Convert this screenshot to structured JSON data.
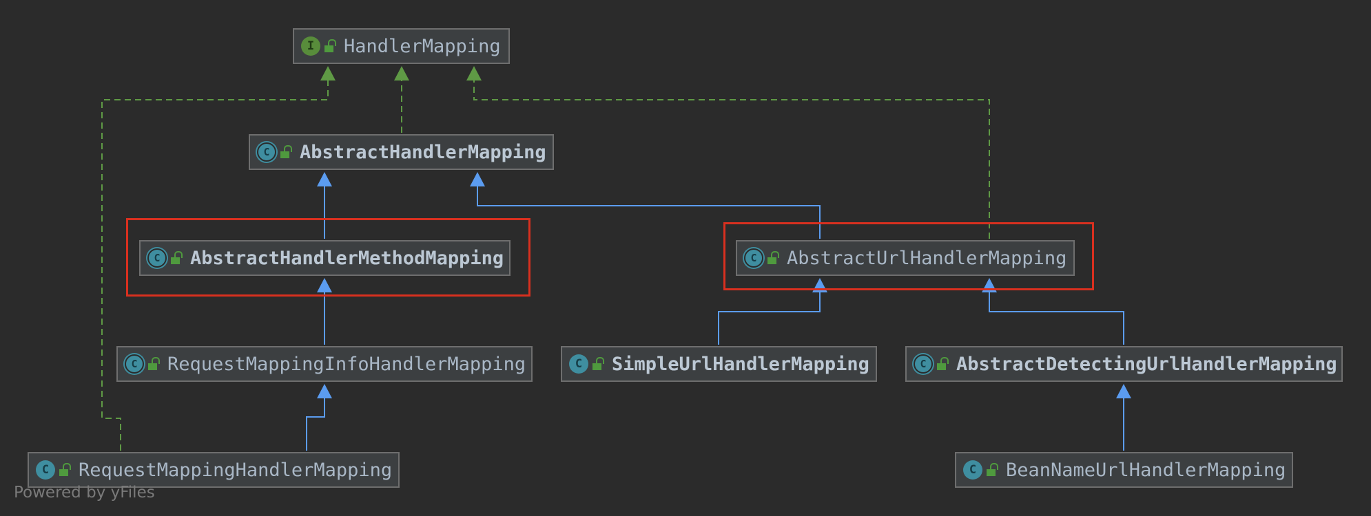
{
  "diagram": {
    "nodes": {
      "handler_mapping": {
        "label": "HandlerMapping",
        "kind": "interface",
        "kind_letter": "I"
      },
      "abstract_handler_mapping": {
        "label": "AbstractHandlerMapping",
        "kind": "abstract-class",
        "kind_letter": "C"
      },
      "abstract_handler_method_mapping": {
        "label": "AbstractHandlerMethodMapping",
        "kind": "abstract-class",
        "kind_letter": "C"
      },
      "abstract_url_handler_mapping": {
        "label": "AbstractUrlHandlerMapping",
        "kind": "abstract-class",
        "kind_letter": "C"
      },
      "request_mapping_info_handler_mapping": {
        "label": "RequestMappingInfoHandlerMapping",
        "kind": "abstract-class",
        "kind_letter": "C"
      },
      "simple_url_handler_mapping": {
        "label": "SimpleUrlHandlerMapping",
        "kind": "class",
        "kind_letter": "C"
      },
      "abstract_detecting_url_handler_mapping": {
        "label": "AbstractDetectingUrlHandlerMapping",
        "kind": "abstract-class",
        "kind_letter": "C"
      },
      "request_mapping_handler_mapping": {
        "label": "RequestMappingHandlerMapping",
        "kind": "class",
        "kind_letter": "C"
      },
      "bean_name_url_handler_mapping": {
        "label": "BeanNameUrlHandlerMapping",
        "kind": "class",
        "kind_letter": "C"
      }
    },
    "edges": [
      {
        "from": "abstract_handler_mapping",
        "to": "handler_mapping",
        "type": "implements"
      },
      {
        "from": "request_mapping_handler_mapping",
        "to": "handler_mapping",
        "type": "implements"
      },
      {
        "from": "abstract_url_handler_mapping",
        "to": "handler_mapping",
        "type": "implements"
      },
      {
        "from": "abstract_handler_method_mapping",
        "to": "abstract_handler_mapping",
        "type": "extends"
      },
      {
        "from": "abstract_url_handler_mapping",
        "to": "abstract_handler_mapping",
        "type": "extends"
      },
      {
        "from": "request_mapping_info_handler_mapping",
        "to": "abstract_handler_method_mapping",
        "type": "extends"
      },
      {
        "from": "request_mapping_handler_mapping",
        "to": "request_mapping_info_handler_mapping",
        "type": "extends"
      },
      {
        "from": "simple_url_handler_mapping",
        "to": "abstract_url_handler_mapping",
        "type": "extends"
      },
      {
        "from": "abstract_detecting_url_handler_mapping",
        "to": "abstract_url_handler_mapping",
        "type": "extends"
      },
      {
        "from": "bean_name_url_handler_mapping",
        "to": "abstract_detecting_url_handler_mapping",
        "type": "extends"
      }
    ],
    "highlighted": [
      "abstract_handler_method_mapping",
      "abstract_url_handler_mapping"
    ]
  },
  "colors": {
    "background": "#2b2b2b",
    "implements_edge": "#5f9a45",
    "extends_edge": "#5b9cf0",
    "highlight": "#d9301f"
  },
  "watermark": "Powered by yFiles"
}
